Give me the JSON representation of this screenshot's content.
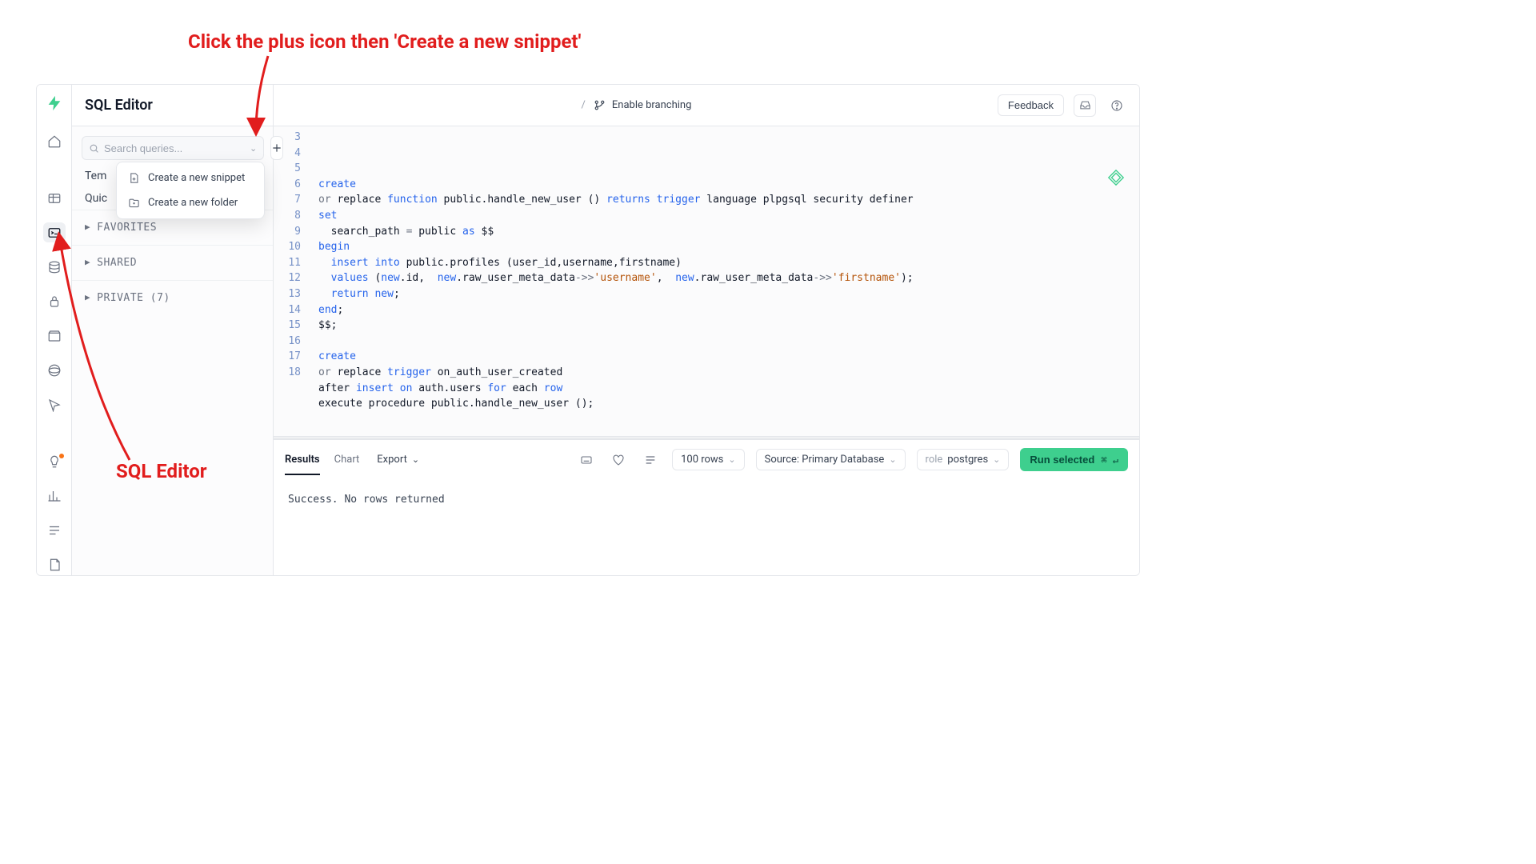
{
  "annotation": {
    "top": "Click the plus icon then 'Create a new snippet'",
    "bottom": "SQL Editor"
  },
  "sidebar": {
    "title": "SQL Editor",
    "search_placeholder": "Search queries...",
    "dropdown": {
      "snippet": "Create a new snippet",
      "folder": "Create a new folder"
    },
    "partial1": "Tem",
    "partial2": "Quic",
    "sections": {
      "favorites": "FAVORITES",
      "shared": "SHARED",
      "private": "PRIVATE (7)"
    }
  },
  "topbar": {
    "slash": "/",
    "branch": "Enable branching",
    "feedback": "Feedback"
  },
  "editor": {
    "lines": [
      {
        "n": 3,
        "html": "&nbsp;"
      },
      {
        "n": 4,
        "html": "<span class='tok-kw'>create</span>"
      },
      {
        "n": 5,
        "html": "<span class='tok-gray'>or</span> replace <span class='tok-kw'>function</span> public.handle_new_user () <span class='tok-kw'>returns</span> <span class='tok-kw'>trigger</span> language plpgsql security definer"
      },
      {
        "n": 6,
        "html": "<span class='tok-kw'>set</span>"
      },
      {
        "n": 7,
        "html": "  search_path <span class='tok-op'>=</span> public <span class='tok-kw'>as</span> $$"
      },
      {
        "n": 8,
        "html": "<span class='tok-kw'>begin</span>"
      },
      {
        "n": 9,
        "html": "  <span class='tok-kw'>insert</span> <span class='tok-kw'>into</span> public.profiles (user_id,username,firstname)"
      },
      {
        "n": 10,
        "html": "  <span class='tok-kw'>values</span> (<span class='tok-kw'>new</span>.id,  <span class='tok-kw'>new</span>.raw_user_meta_data<span class='tok-op'>-&gt;&gt;</span><span class='tok-str'>'username'</span>,  <span class='tok-kw'>new</span>.raw_user_meta_data<span class='tok-op'>-&gt;&gt;</span><span class='tok-str'>'firstname'</span>);"
      },
      {
        "n": 11,
        "html": "  <span class='tok-kw'>return</span> <span class='tok-kw'>new</span>;"
      },
      {
        "n": 12,
        "html": "<span class='tok-kw'>end</span>;"
      },
      {
        "n": 13,
        "html": "$$;"
      },
      {
        "n": 14,
        "html": "&nbsp;"
      },
      {
        "n": 15,
        "html": "<span class='tok-kw'>create</span>"
      },
      {
        "n": 16,
        "html": "<span class='tok-gray'>or</span> replace <span class='tok-kw'>trigger</span> on_auth_user_created"
      },
      {
        "n": 17,
        "html": "after <span class='tok-kw'>insert</span> <span class='tok-kw'>on</span> auth.users <span class='tok-kw'>for</span> each <span class='tok-kw'>row</span>"
      },
      {
        "n": 18,
        "html": "execute procedure public.handle_new_user ();"
      }
    ]
  },
  "results": {
    "tabs": {
      "results": "Results",
      "chart": "Chart",
      "export": "Export"
    },
    "rows": "100 rows",
    "source": "Source: Primary Database",
    "role_label": "role",
    "role_value": "postgres",
    "run": "Run selected",
    "kbd": "⌘ ↵",
    "status": "Success. No rows returned"
  }
}
